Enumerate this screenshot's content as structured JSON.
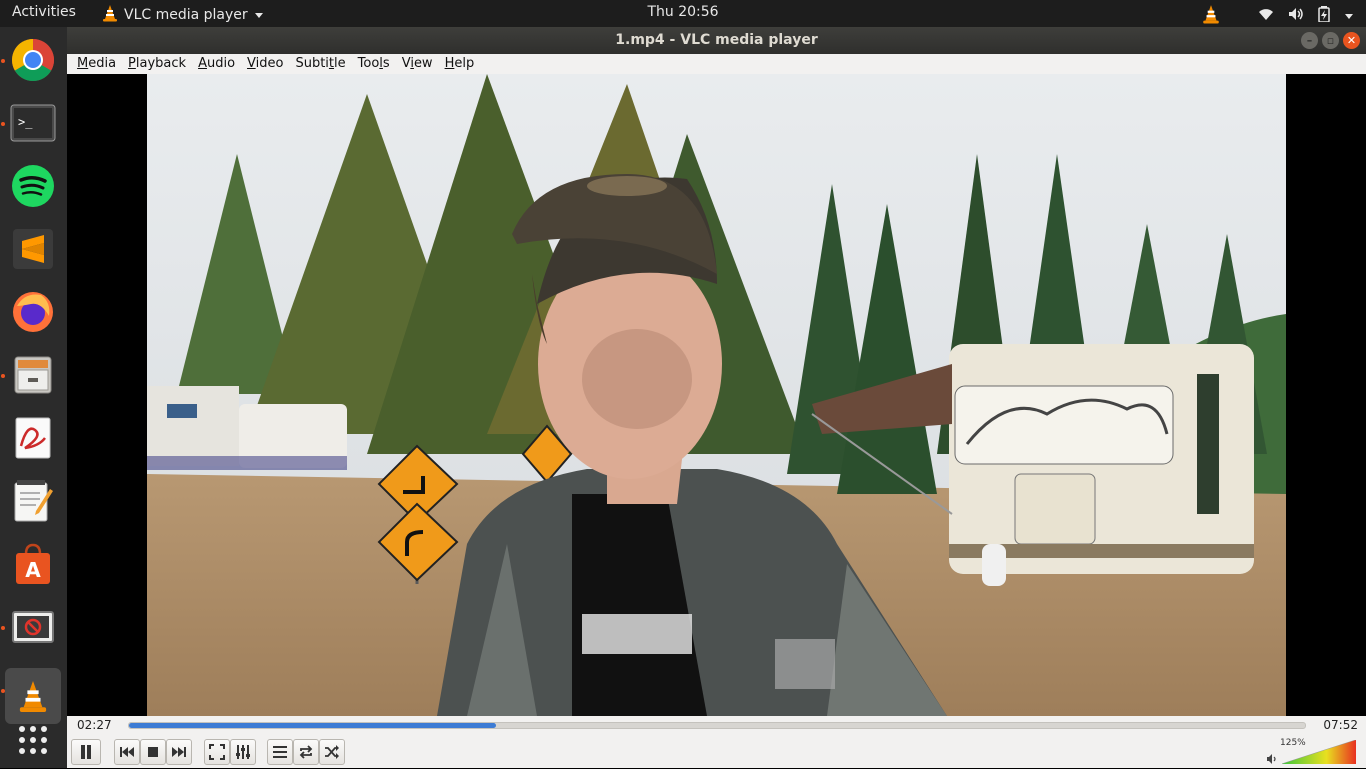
{
  "topbar": {
    "activities": "Activities",
    "app_name": "VLC media player",
    "clock": "Thu 20:56"
  },
  "dock": {
    "items": [
      "Google Chrome",
      "Terminal",
      "Spotify",
      "Sublime Text",
      "Firefox",
      "Files",
      "Document Viewer",
      "Text Editor",
      "Ubuntu Software",
      "Screen Recorder",
      "VLC media player",
      "Show Applications"
    ]
  },
  "window": {
    "title": "1.mp4 - VLC media player"
  },
  "menubar": {
    "items": [
      {
        "pre": "",
        "key": "M",
        "post": "edia"
      },
      {
        "pre": "",
        "key": "P",
        "post": "layback"
      },
      {
        "pre": "",
        "key": "A",
        "post": "udio"
      },
      {
        "pre": "",
        "key": "V",
        "post": "ideo"
      },
      {
        "pre": "Subti",
        "key": "t",
        "post": "le"
      },
      {
        "pre": "Too",
        "key": "l",
        "post": "s"
      },
      {
        "pre": "V",
        "key": "i",
        "post": "ew"
      },
      {
        "pre": "",
        "key": "H",
        "post": "elp"
      }
    ]
  },
  "player": {
    "time_elapsed": "02:27",
    "time_total": "07:52",
    "progress": 0.312,
    "volume_label": "125%",
    "volume": 1.25
  },
  "colors": {
    "accent": "#3c7bd4",
    "ubuntu_orange": "#e95420",
    "topbar": "#1d1d1d",
    "dock": "#2b2b2b"
  }
}
